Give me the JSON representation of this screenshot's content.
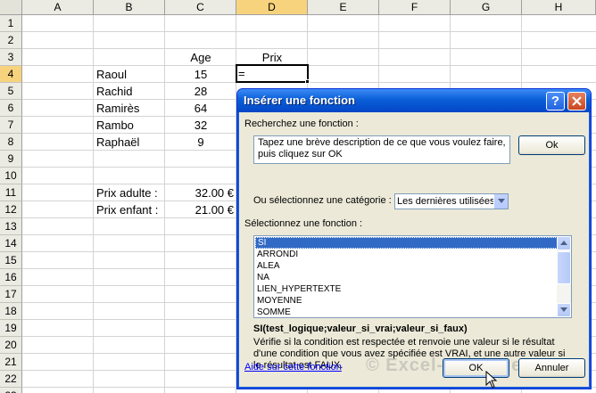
{
  "spreadsheet": {
    "columns": [
      "A",
      "B",
      "C",
      "D",
      "E",
      "F",
      "G",
      "H"
    ],
    "selected_column": "D",
    "rows": [
      "1",
      "2",
      "3",
      "4",
      "5",
      "6",
      "7",
      "8",
      "9",
      "10",
      "11",
      "12",
      "13",
      "14",
      "15",
      "16",
      "17",
      "18",
      "19",
      "20",
      "21",
      "22",
      "23"
    ],
    "selected_row": "4",
    "headers": {
      "age": "Age",
      "prix": "Prix"
    },
    "people": [
      {
        "name": "Raoul",
        "age": "15"
      },
      {
        "name": "Rachid",
        "age": "28"
      },
      {
        "name": "Ramirès",
        "age": "64"
      },
      {
        "name": "Rambo",
        "age": "32"
      },
      {
        "name": "Raphaël",
        "age": "9"
      }
    ],
    "prix_adulte_label": "Prix adulte :",
    "prix_adulte_value": "32.00 €",
    "prix_enfant_label": "Prix enfant :",
    "prix_enfant_value": "21.00 €",
    "active_cell_value": "="
  },
  "dialog": {
    "title": "Insérer une fonction",
    "help_button": "?",
    "search_label": "Recherchez une fonction :",
    "search_text": "Tapez une brève description de ce que vous voulez faire, puis cliquez sur OK",
    "ok_search_label": "Ok",
    "category_label": "Ou sélectionnez une catégorie :",
    "category_value": "Les dernières utilisées",
    "select_function_label": "Sélectionnez une fonction :",
    "functions": [
      "SI",
      "ARRONDI",
      "ALEA",
      "NA",
      "LIEN_HYPERTEXTE",
      "MOYENNE",
      "SOMME"
    ],
    "selected_function": "SI",
    "signature": "SI(test_logique;valeur_si_vrai;valeur_si_faux)",
    "description": "Vérifie si la condition est respectée et renvoie une valeur si le résultat d'une condition que vous avez spécifiée est VRAI, et une autre valeur si le résultat est FAUX.",
    "help_link": "Aide sur cette fonction",
    "ok_label": "OK",
    "cancel_label": "Annuler"
  },
  "watermark": "© Excel-Pratique.com",
  "colors": {
    "selection_blue": "#316ac5",
    "title_blue": "#0a5fd8",
    "header_highlight": "#f7d37d"
  }
}
